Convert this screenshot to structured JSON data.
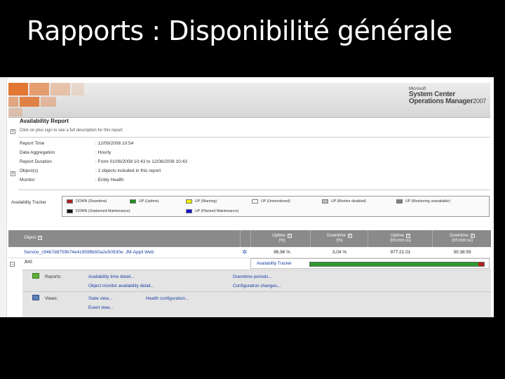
{
  "slide": {
    "title": "Rapports : Disponibilité générale"
  },
  "banner": {
    "brand_line1": "Microsoft",
    "brand_line2": "System Center",
    "brand_line3": "Operations Manager",
    "brand_year": "2007",
    "accent_color": "#e06a1e"
  },
  "report": {
    "title": "Availability Report",
    "hint": "Click on plus sign to see a full description for this report",
    "properties": [
      {
        "key": "Report Time",
        "value": ": 12/09/2008 10:54"
      },
      {
        "key": "Data Aggregation",
        "value": ": Hourly"
      },
      {
        "key": "Report Duration",
        "value": ": From  01/06/2008 10:43  to  12/06/2008 10:43"
      },
      {
        "key": "Object(s)",
        "value": ": 1 objects included in this report"
      },
      {
        "key": "Monitor",
        "value": ": Entity Health"
      }
    ]
  },
  "tracker_legend": {
    "label": "Availability Tracker",
    "items": [
      {
        "label": "DOWN (Downtime)",
        "color": "#b22222"
      },
      {
        "label": "UP (Uptime)",
        "color": "#1f8f1f"
      },
      {
        "label": "UP (Warning)",
        "color": "#f0f000"
      },
      {
        "label": "UP (Unmonitored)",
        "color": "#ffffff"
      },
      {
        "label": "UP (Monitor disabled)",
        "color": "#c0c0c0"
      },
      {
        "label": "UP (Monitoring unavailable)",
        "color": "#808080"
      },
      {
        "label": "DOWN (Unplanned Maintenance)",
        "color": "#111111"
      },
      {
        "label": "UP (Planned Maintenance)",
        "color": "#1010d0"
      }
    ]
  },
  "grid": {
    "headers": {
      "object": "Object",
      "uptime_pct_1": "Uptime",
      "uptime_pct_2": "(%)",
      "downtime_pct_1": "Downtime",
      "downtime_pct_2": "(%)",
      "uptime_hms_1": "Uptime",
      "uptime_hms_2": "(hh:mm:ss)",
      "downtime_hms_1": "Downtime",
      "downtime_hms_2": "(hh:mm:ss)",
      "sort_glyph": "≡"
    },
    "row": {
      "object": "Service_c94b7d8759b74e41959Bb50a2e50930e: JM-Appli Web",
      "subobject": "JMS",
      "uptime_pct": "96,96 %",
      "downtime_pct": "3,04 %",
      "uptime_hms": "977:21:01",
      "downtime_hms": "30:38:59",
      "uptime_fraction": 0.9696
    },
    "tracker_link": "Availability Tracker",
    "reports": {
      "label": "Reports:",
      "links": [
        "Availability time detail...",
        "Downtime periods...",
        "Object monitor availability detail...",
        "Configuration changes..."
      ]
    },
    "views": {
      "label": "Views:",
      "links": [
        "State view...",
        "Health configuration...",
        "Event view..."
      ]
    }
  }
}
